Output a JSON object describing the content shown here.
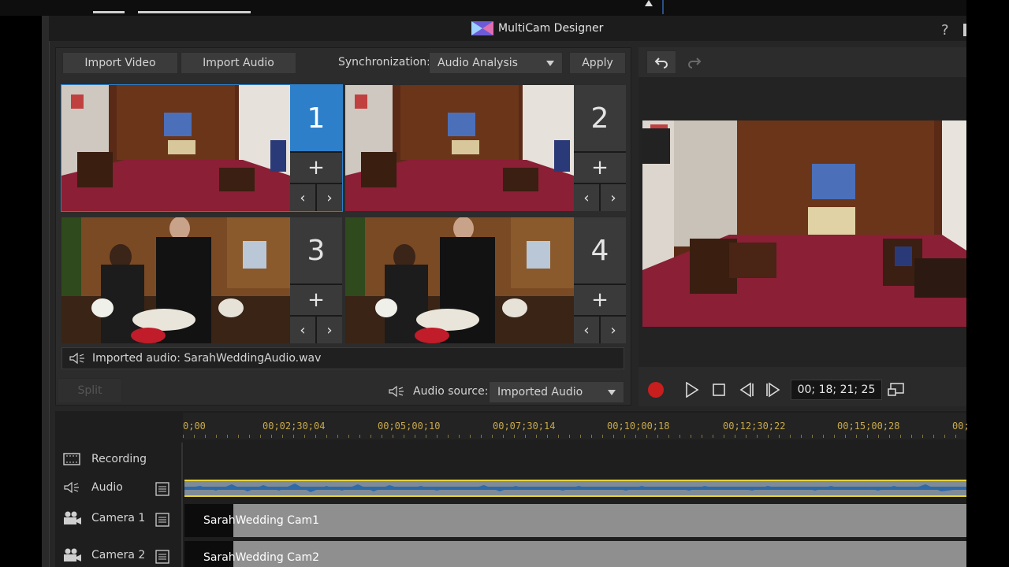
{
  "window": {
    "title": "MultiCam Designer",
    "help": "?"
  },
  "toolbar": {
    "import_video": "Import Video",
    "import_audio": "Import Audio",
    "sync_label": "Synchronization:",
    "sync_value": "Audio Analysis",
    "apply": "Apply"
  },
  "cameras": [
    {
      "number": "1",
      "active": true
    },
    {
      "number": "2",
      "active": false
    },
    {
      "number": "3",
      "active": false
    },
    {
      "number": "4",
      "active": false
    }
  ],
  "icons": {
    "plus": "+",
    "prev": "‹",
    "next": "›"
  },
  "imported_audio": "Imported audio: SarahWeddingAudio.wav",
  "split": "Split",
  "audio_source": {
    "label": "Audio source:",
    "value": "Imported Audio"
  },
  "playback": {
    "timecode": "00; 18; 21; 25"
  },
  "ruler": [
    "0;00",
    "00;02;30;04",
    "00;05;00;10",
    "00;07;30;14",
    "00;10;00;18",
    "00;12;30;22",
    "00;15;00;28",
    "00;"
  ],
  "tracks": {
    "recording": "Recording",
    "audio": "Audio",
    "camera1": "Camera 1",
    "camera2": "Camera 2",
    "clip1": "SarahWedding Cam1",
    "clip2": "SarahWedding Cam2"
  },
  "colors": {
    "accent": "#2d7fc9",
    "record": "#c81e1e",
    "waveform": "#2f6aa6",
    "timecode_ticks": "#c9a94a"
  }
}
